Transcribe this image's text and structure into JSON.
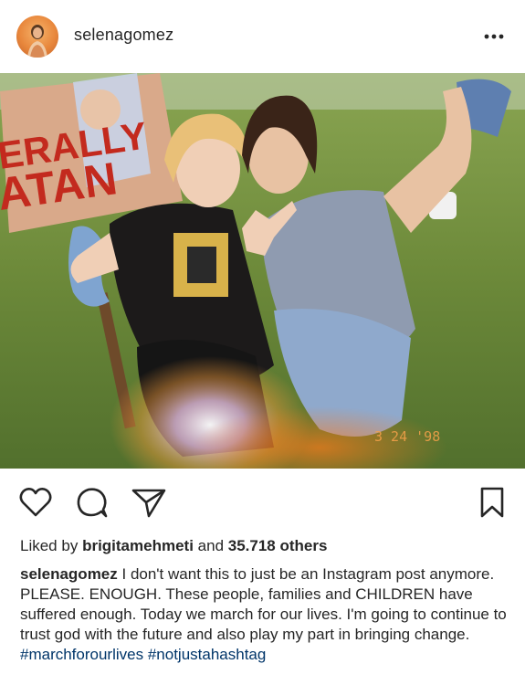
{
  "post": {
    "username": "selenagomez",
    "more_icon": "ellipsis-horizontal-icon",
    "photo_timestamp": "3 24 '98",
    "photo_sign": "ERALLY SATAN"
  },
  "actions": {
    "like_icon": "heart-outline-icon",
    "comment_icon": "comment-bubble-icon",
    "share_icon": "paper-plane-icon",
    "save_icon": "bookmark-outline-icon"
  },
  "likes": {
    "prefix": "Liked by",
    "user": "brigitamehmeti",
    "connector": "and",
    "others": "35.718 others"
  },
  "caption": {
    "username": "selenagomez",
    "text": "I don't want this to just be an Instagram post anymore. PLEASE. ENOUGH. These people, families and CHILDREN have suffered enough. Today we march for our lives. I'm going to continue to trust god with the future and also play my part in bringing change.",
    "hashtags": [
      "#marchforourlives",
      "#notjustahashtag"
    ]
  },
  "colors": {
    "text": "#262626",
    "hashtag": "#003569",
    "avatar_ring": "#e8873c"
  }
}
